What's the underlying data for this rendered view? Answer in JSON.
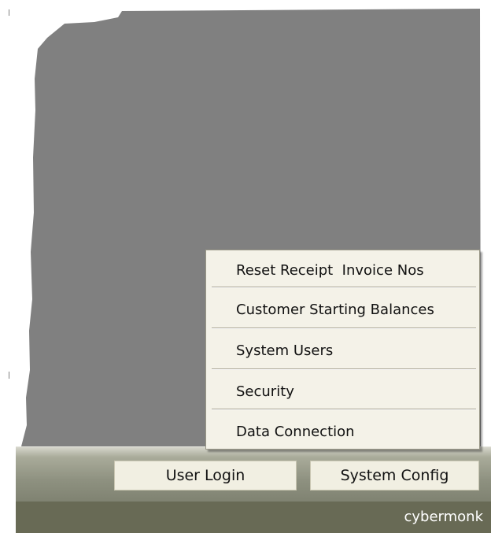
{
  "menu": {
    "items": [
      {
        "label": "Reset Receipt  Invoice Nos"
      },
      {
        "label": "Customer Starting Balances"
      },
      {
        "label": "System Users"
      },
      {
        "label": "Security"
      },
      {
        "label": "Data Connection"
      }
    ]
  },
  "taskbar": {
    "user_login_label": "User Login",
    "system_config_label": "System Config"
  },
  "status": {
    "username": "cybermonk"
  },
  "colors": {
    "workspace": "#808080",
    "menu_bg": "#f4f2e8",
    "button_bg": "#f1efe2",
    "status_bar": "#686a55"
  }
}
